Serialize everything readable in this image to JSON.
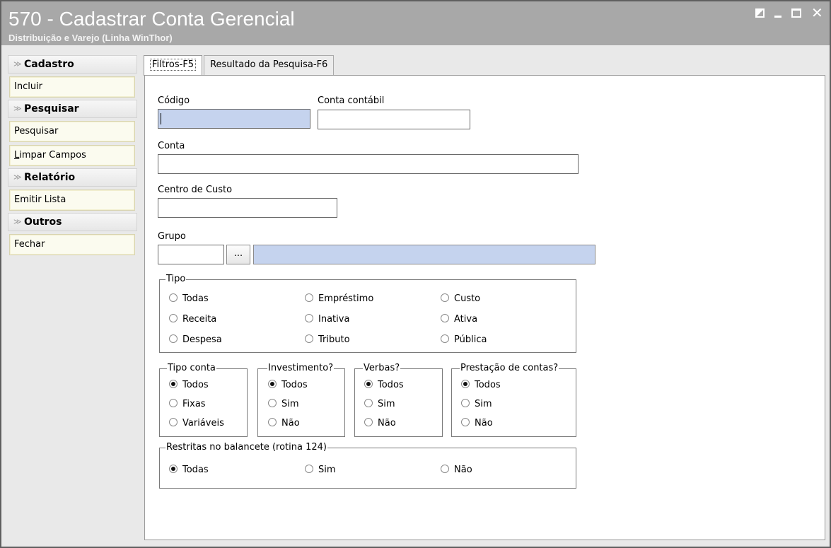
{
  "window": {
    "title": "570 - Cadastrar Conta Gerencial",
    "subtitle": "Distribuição e Varejo (Linha WinThor)"
  },
  "sidebar": {
    "groups": [
      {
        "title": "Cadastro",
        "items": [
          "Incluir"
        ]
      },
      {
        "title": "Pesquisar",
        "items": [
          "Pesquisar",
          "Limpar Campos"
        ]
      },
      {
        "title": "Relatório",
        "items": [
          "Emitir Lista"
        ]
      },
      {
        "title": "Outros",
        "items": [
          "Fechar"
        ]
      }
    ]
  },
  "tabs": [
    {
      "label": "Filtros-F5",
      "active": true
    },
    {
      "label": "Resultado da Pesquisa-F6",
      "active": false
    }
  ],
  "form": {
    "codigo": {
      "label": "Código",
      "value": ""
    },
    "conta_contabil": {
      "label": "Conta contábil",
      "value": ""
    },
    "conta": {
      "label": "Conta",
      "value": ""
    },
    "centro_custo": {
      "label": "Centro de Custo",
      "value": ""
    },
    "grupo": {
      "label": "Grupo",
      "value": "",
      "button": "...",
      "description": ""
    }
  },
  "tipo": {
    "title": "Tipo",
    "options": [
      "Todas",
      "Empréstimo",
      "Custo",
      "Receita",
      "Inativa",
      "Ativa",
      "Despesa",
      "Tributo",
      "Pública"
    ],
    "selected": null
  },
  "tipo_conta": {
    "title": "Tipo conta",
    "options": [
      "Todos",
      "Fixas",
      "Variáveis"
    ],
    "selected": "Todos"
  },
  "investimento": {
    "title": "Investimento?",
    "options": [
      "Todos",
      "Sim",
      "Não"
    ],
    "selected": "Todos"
  },
  "verbas": {
    "title": "Verbas?",
    "options": [
      "Todos",
      "Sim",
      "Não"
    ],
    "selected": "Todos"
  },
  "prestacao": {
    "title": "Prestação de contas?",
    "options": [
      "Todos",
      "Sim",
      "Não"
    ],
    "selected": "Todos"
  },
  "restritas": {
    "title": "Restritas no balancete (rotina 124)",
    "options": [
      "Todas",
      "Sim",
      "Não"
    ],
    "selected": "Todas"
  }
}
